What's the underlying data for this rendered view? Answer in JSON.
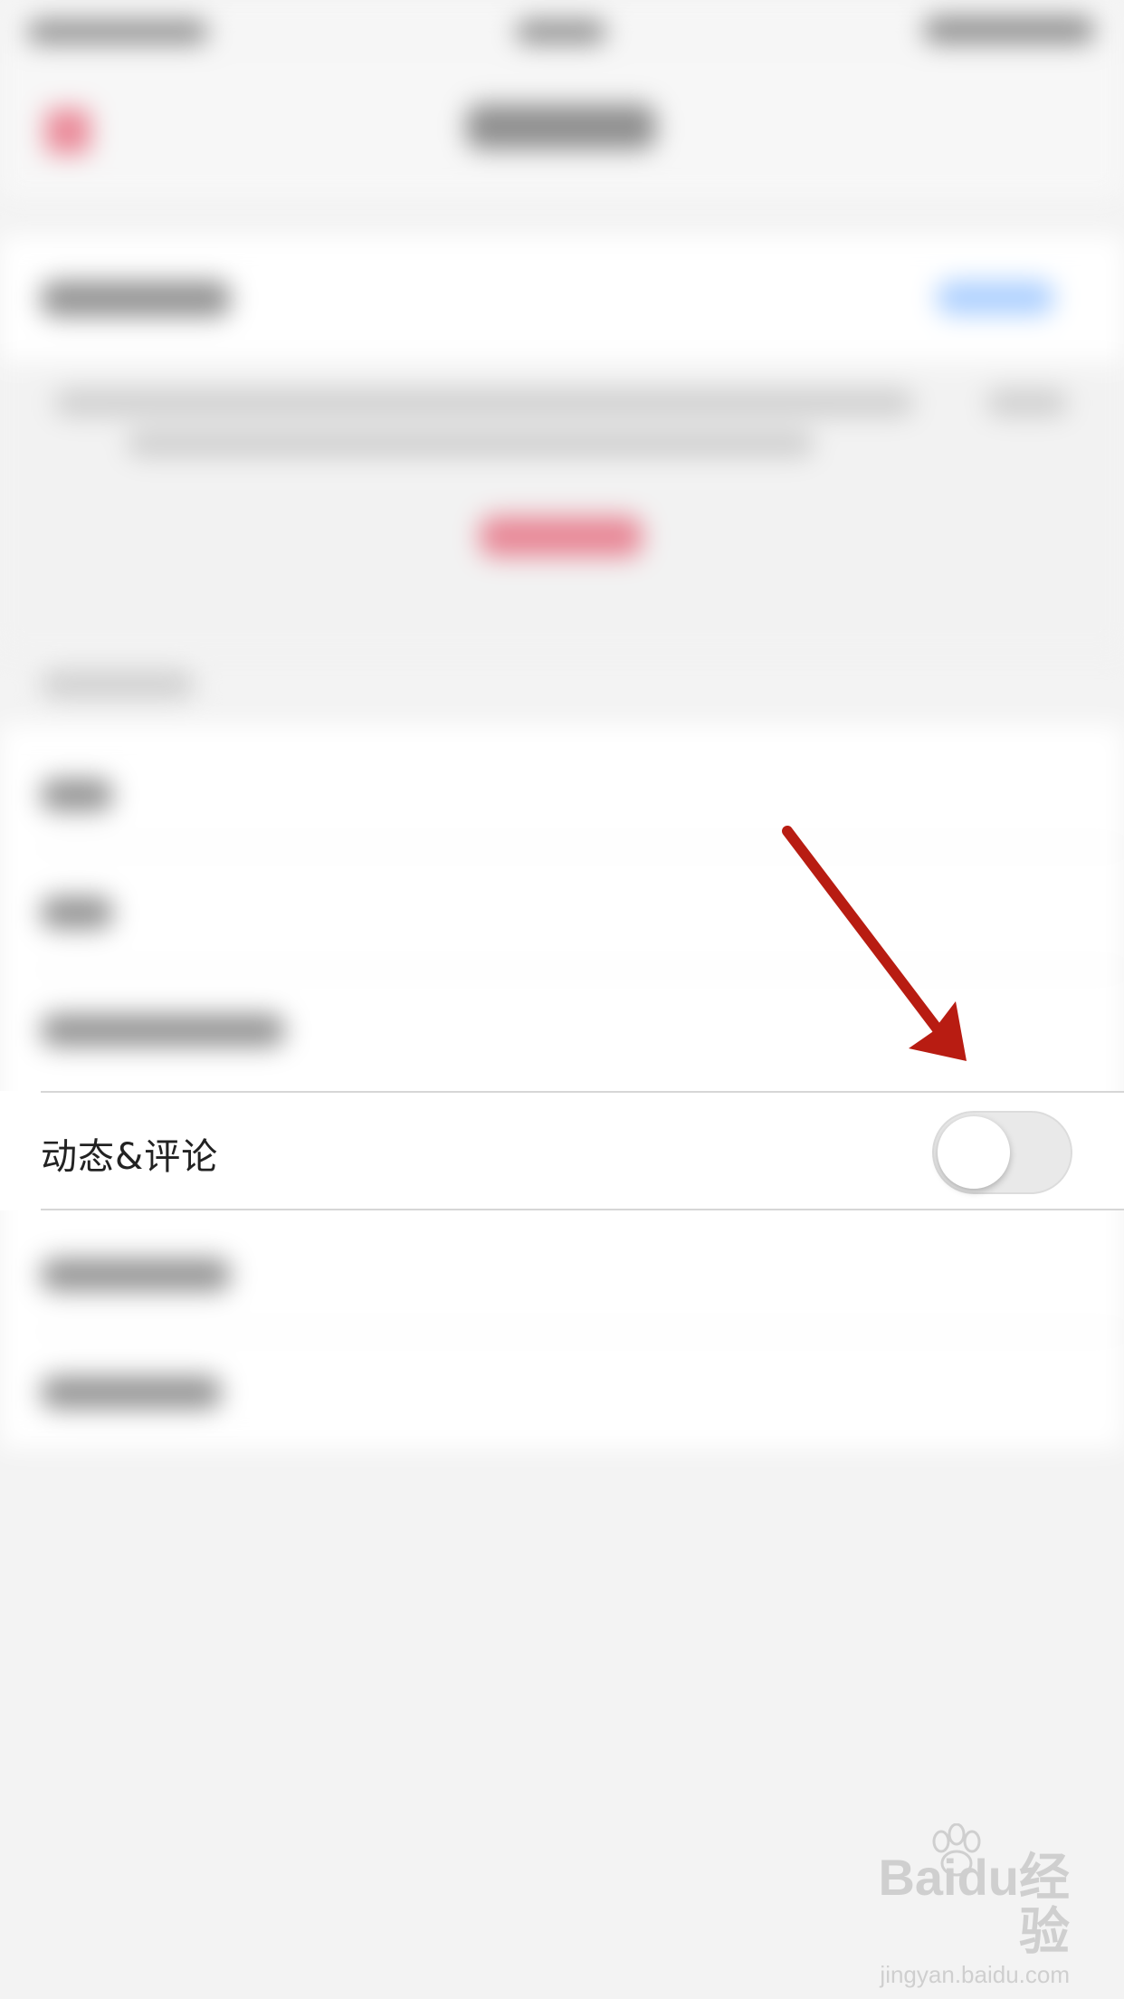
{
  "setting_row": {
    "label": "动态&评论",
    "toggle_on": false
  },
  "annotation": {
    "type": "arrow",
    "color": "#b81c12",
    "target": "toggle"
  },
  "watermark": {
    "logo_text": "Baidu经验",
    "url": "jingyan.baidu.com"
  },
  "colors": {
    "background": "#f3f3f3",
    "row_background": "#ffffff",
    "toggle_off": "#e9e9e9"
  }
}
